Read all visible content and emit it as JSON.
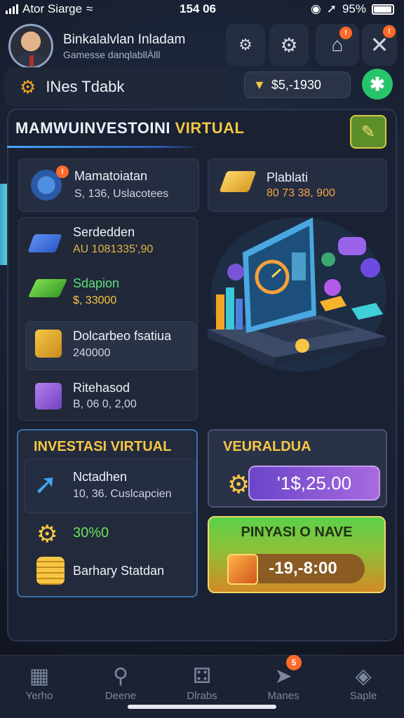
{
  "status_bar": {
    "carrier": "Ator Siarge",
    "time": "154 06",
    "battery": "95%",
    "battery_level": 0.95
  },
  "header": {
    "user_name": "Binkalalvlan Inladam",
    "user_subtitle": "Gamesse danqlabllÀlll",
    "tab_label": "INes Tdabk",
    "balance": "$5,-1930",
    "badge_home": "!",
    "badge_close": "!"
  },
  "main": {
    "title_main": "MAMWUINVESTOINI ",
    "title_highlight": "VIRTUAL",
    "items": [
      {
        "title": "Mamatoiatan",
        "value": "S, 136, Uslacotees"
      },
      {
        "title": "Serdedden",
        "value": "AU 1081335',90"
      },
      {
        "title": "Sdapion",
        "value": "$, 33000"
      },
      {
        "title": "Dolcarbeo fsatiua",
        "value": "240000"
      },
      {
        "title": "Ritehasod",
        "value": "B, 06 0, 2,00"
      }
    ],
    "plaque": {
      "title": "Plablati",
      "value": "80 73 38, 900"
    }
  },
  "invest": {
    "title": "INVESTASI VIRTUAL",
    "row1_title": "Nctadhen",
    "row1_value": "10, 36. Cuslcapcien",
    "row2_value": "30%0",
    "row3_title": "Barhary Statdan"
  },
  "virtual": {
    "title": "VEURALDUA",
    "amount": "'1$,25.00"
  },
  "payment": {
    "title": "PINYASI O NAVE",
    "amount": "-19,-8:00"
  },
  "nav": [
    {
      "label": "Yerho",
      "icon": "grid-chart-icon"
    },
    {
      "label": "Deene",
      "icon": "search-icon"
    },
    {
      "label": "Dlrabs",
      "icon": "dice-icon"
    },
    {
      "label": "Manes",
      "icon": "rocket-icon",
      "badge": "5"
    },
    {
      "label": "Saple",
      "icon": "shield-icon"
    }
  ],
  "colors": {
    "accent": "#f6c744",
    "green": "#27c46a",
    "purple": "#8a5ad8",
    "panel": "#1a2132"
  }
}
